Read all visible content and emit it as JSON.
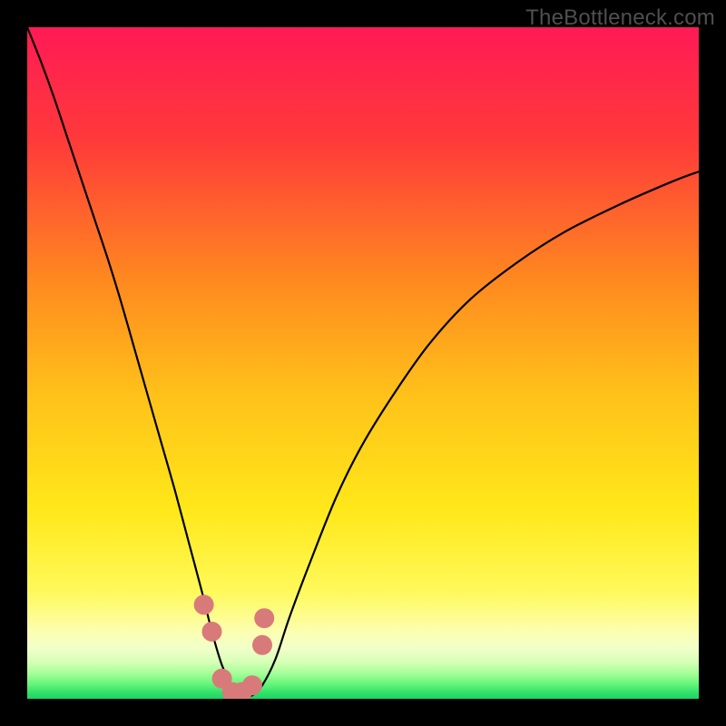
{
  "watermark": "TheBottleneck.com",
  "chart_data": {
    "type": "line",
    "title": "",
    "xlabel": "",
    "ylabel": "",
    "xlim": [
      0,
      100
    ],
    "ylim": [
      0,
      100
    ],
    "series": [
      {
        "name": "bottleneck-curve",
        "x": [
          0,
          2,
          4,
          6,
          8,
          10,
          12,
          14,
          16,
          18,
          20,
          22,
          24,
          26,
          27.5,
          29,
          30.5,
          32,
          33.5,
          35,
          37,
          39,
          42,
          46,
          50,
          55,
          60,
          66,
          73,
          80,
          88,
          96,
          100
        ],
        "y": [
          100,
          95,
          89.5,
          83.5,
          77.5,
          71.5,
          65.5,
          59,
          52,
          45,
          38,
          31,
          23.5,
          16,
          10,
          5,
          2,
          0.5,
          0.5,
          2,
          6,
          12,
          20,
          30,
          38,
          46,
          53,
          59.5,
          65,
          69.5,
          73.5,
          77,
          78.5
        ]
      }
    ],
    "markers": {
      "name": "highlight-dots",
      "color": "#d97a7a",
      "x": [
        26.3,
        27.5,
        29.0,
        30.5,
        32.0,
        33.5,
        35.0,
        35.3
      ],
      "y": [
        14,
        10,
        3,
        1,
        1,
        2,
        8,
        12
      ]
    },
    "gradient_stops": [
      {
        "offset": 0,
        "color": "#ff1a55"
      },
      {
        "offset": 0.17,
        "color": "#ff3a3a"
      },
      {
        "offset": 0.38,
        "color": "#ff8a1f"
      },
      {
        "offset": 0.55,
        "color": "#ffc21a"
      },
      {
        "offset": 0.72,
        "color": "#ffe81a"
      },
      {
        "offset": 0.84,
        "color": "#fff95a"
      },
      {
        "offset": 0.9,
        "color": "#fcffb0"
      },
      {
        "offset": 0.925,
        "color": "#f1ffc9"
      },
      {
        "offset": 0.945,
        "color": "#d6ffb6"
      },
      {
        "offset": 0.962,
        "color": "#a6ff99"
      },
      {
        "offset": 0.978,
        "color": "#66f57a"
      },
      {
        "offset": 0.992,
        "color": "#2de06a"
      },
      {
        "offset": 1.0,
        "color": "#1fd464"
      }
    ]
  }
}
